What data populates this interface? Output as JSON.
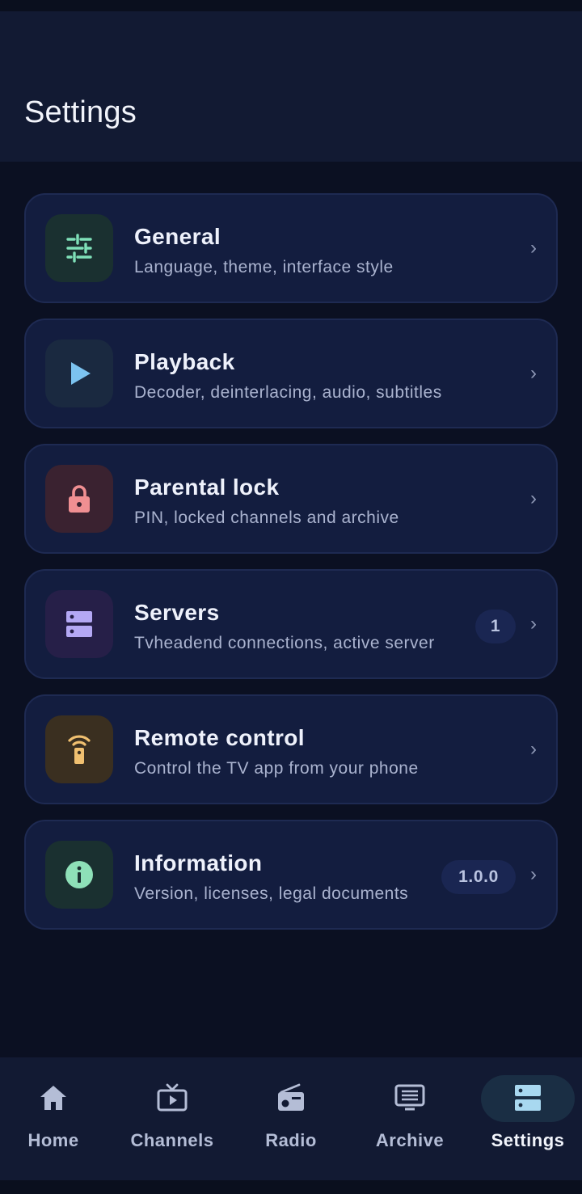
{
  "header": {
    "title": "Settings"
  },
  "settings": [
    {
      "title": "General",
      "subtitle": "Language, theme, interface style",
      "icon": "sliders-icon",
      "icon_bg": "#1a3030",
      "icon_color": "#7fe0b8",
      "badge": null
    },
    {
      "title": "Playback",
      "subtitle": "Decoder, deinterlacing, audio, subtitles",
      "icon": "play-icon",
      "icon_bg": "#1a2940",
      "icon_color": "#7cc3f0",
      "badge": null
    },
    {
      "title": "Parental lock",
      "subtitle": "PIN, locked channels and archive",
      "icon": "lock-icon",
      "icon_bg": "#3a2230",
      "icon_color": "#f08f92",
      "badge": null
    },
    {
      "title": "Servers",
      "subtitle": "Tvheadend connections, active server",
      "icon": "server-icon",
      "icon_bg": "#261f48",
      "icon_color": "#b4a8f4",
      "badge": "1"
    },
    {
      "title": "Remote control",
      "subtitle": "Control the TV app from your phone",
      "icon": "remote-icon",
      "icon_bg": "#3a2f20",
      "icon_color": "#f0c070",
      "badge": null
    },
    {
      "title": "Information",
      "subtitle": "Version, licenses, legal documents",
      "icon": "info-icon",
      "icon_bg": "#1a3030",
      "icon_color": "#8ee0b8",
      "badge": "1.0.0"
    }
  ],
  "nav": [
    {
      "label": "Home",
      "icon": "home-icon",
      "active": false
    },
    {
      "label": "Channels",
      "icon": "tv-icon",
      "active": false
    },
    {
      "label": "Radio",
      "icon": "radio-icon",
      "active": false
    },
    {
      "label": "Archive",
      "icon": "archive-icon",
      "active": false
    },
    {
      "label": "Settings",
      "icon": "server-icon",
      "active": true
    }
  ],
  "colors": {
    "background": "#0b1022",
    "card": "#131d3f",
    "appbar": "#121a33",
    "active_nav_icon": "#a8d8f0",
    "nav_icon": "#b4bdd6"
  }
}
